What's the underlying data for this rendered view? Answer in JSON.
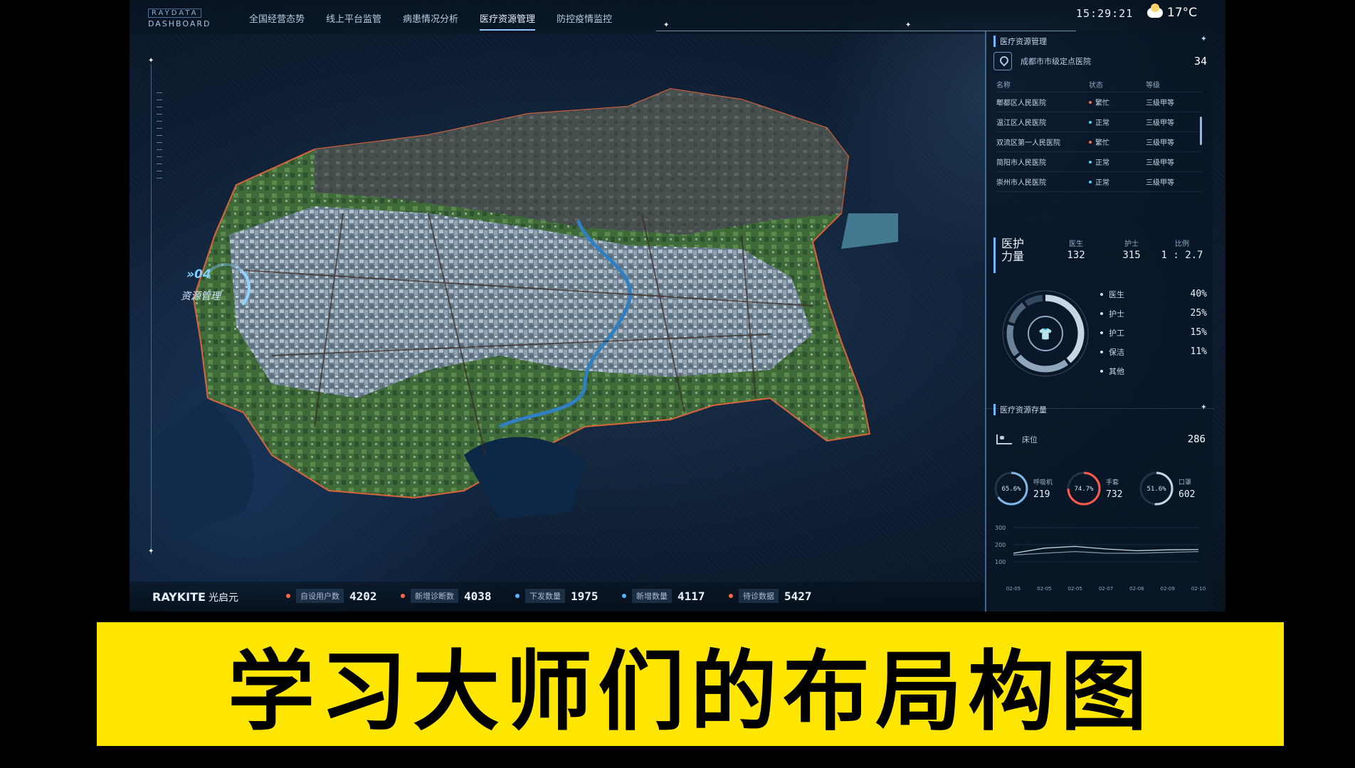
{
  "header": {
    "logo_top": "RAYDATA",
    "logo_bottom": "DASHBOARD",
    "nav": [
      {
        "label": "全国经营态势",
        "active": false
      },
      {
        "label": "线上平台监管",
        "active": false
      },
      {
        "label": "病患情况分析",
        "active": false
      },
      {
        "label": "医疗资源管理",
        "active": true
      },
      {
        "label": "防控疫情监控",
        "active": false
      }
    ],
    "time": "15:29:21",
    "temperature": "17°C",
    "weather_icon": "cloud-sun-icon"
  },
  "left_badge": {
    "num": "»04",
    "label": "资源管理"
  },
  "bottom_bar": {
    "brand": "RAYKITE",
    "brand_cn": "光启元",
    "stats": [
      {
        "label": "自设用户数",
        "value": "4202",
        "color": "#ff6a3d"
      },
      {
        "label": "新增诊断数",
        "value": "4038",
        "color": "#ff6a3d"
      },
      {
        "label": "下发数量",
        "value": "1975",
        "color": "#4fb8ff"
      },
      {
        "label": "新增数量",
        "value": "4117",
        "color": "#4fb8ff"
      },
      {
        "label": "待诊数据",
        "value": "5427",
        "color": "#ff6a3d"
      }
    ]
  },
  "right_panel": {
    "hospital_section_title": "医疗资源管理",
    "hospital_summary_label": "成都市市级定点医院",
    "hospital_summary_count": "34",
    "table_headers": [
      "名称",
      "状态",
      "等级"
    ],
    "hospitals": [
      {
        "name": "郫都区人民医院",
        "status": "繁忙",
        "level": "三级甲等",
        "status_color": "#ff6a3d"
      },
      {
        "name": "温江区人民医院",
        "status": "正常",
        "level": "三级甲等",
        "status_color": "#4fd1ff"
      },
      {
        "name": "双流区第一人民医院",
        "status": "繁忙",
        "level": "三级甲等",
        "status_color": "#ff6a3d"
      },
      {
        "name": "简阳市人民医院",
        "status": "正常",
        "level": "三级甲等",
        "status_color": "#4fd1ff"
      },
      {
        "name": "崇州市人民医院",
        "status": "正常",
        "level": "三级甲等",
        "status_color": "#4fd1ff"
      }
    ],
    "staff": {
      "title": "医护力量",
      "cols": [
        {
          "h": "医生",
          "v": "132"
        },
        {
          "h": "护士",
          "v": "315"
        },
        {
          "h": "比例",
          "v": "1 : 2.7"
        }
      ]
    },
    "donut": [
      {
        "name": "医生",
        "pct": "40%",
        "value": 40,
        "color": "#c8d6e4"
      },
      {
        "name": "护士",
        "pct": "25%",
        "value": 25,
        "color": "#8fa6bd"
      },
      {
        "name": "护工",
        "pct": "15%",
        "value": 15,
        "color": "#6b8299"
      },
      {
        "name": "保洁",
        "pct": "11%",
        "value": 11,
        "color": "#4d6379"
      },
      {
        "name": "其他",
        "pct": "",
        "value": 9,
        "color": "#34495e"
      }
    ],
    "reserve_section_title": "医疗资源存量",
    "beds_label": "床位",
    "beds_value": "286",
    "rings": [
      {
        "pct": "65.6%",
        "value": 65.6,
        "label": "呼吸机",
        "num": "219",
        "color": "#7fb6e6"
      },
      {
        "pct": "74.7%",
        "value": 74.7,
        "label": "手套",
        "num": "732",
        "color": "#ff5a4a"
      },
      {
        "pct": "51.6%",
        "value": 51.6,
        "label": "口罩",
        "num": "602",
        "color": "#c8d6e4"
      }
    ]
  },
  "chart_data": {
    "type": "line",
    "x": [
      "02-05",
      "02-05",
      "02-05",
      "02-07",
      "02-08",
      "02-09",
      "02-10"
    ],
    "series": [
      {
        "values": [
          150,
          180,
          190,
          175,
          165,
          170,
          172
        ]
      },
      {
        "values": [
          140,
          150,
          160,
          150,
          150,
          155,
          160
        ]
      }
    ],
    "ylim": [
      0,
      300
    ],
    "yticks": [
      "300",
      "200",
      "100"
    ]
  },
  "caption": "学习大师们的布局构图"
}
